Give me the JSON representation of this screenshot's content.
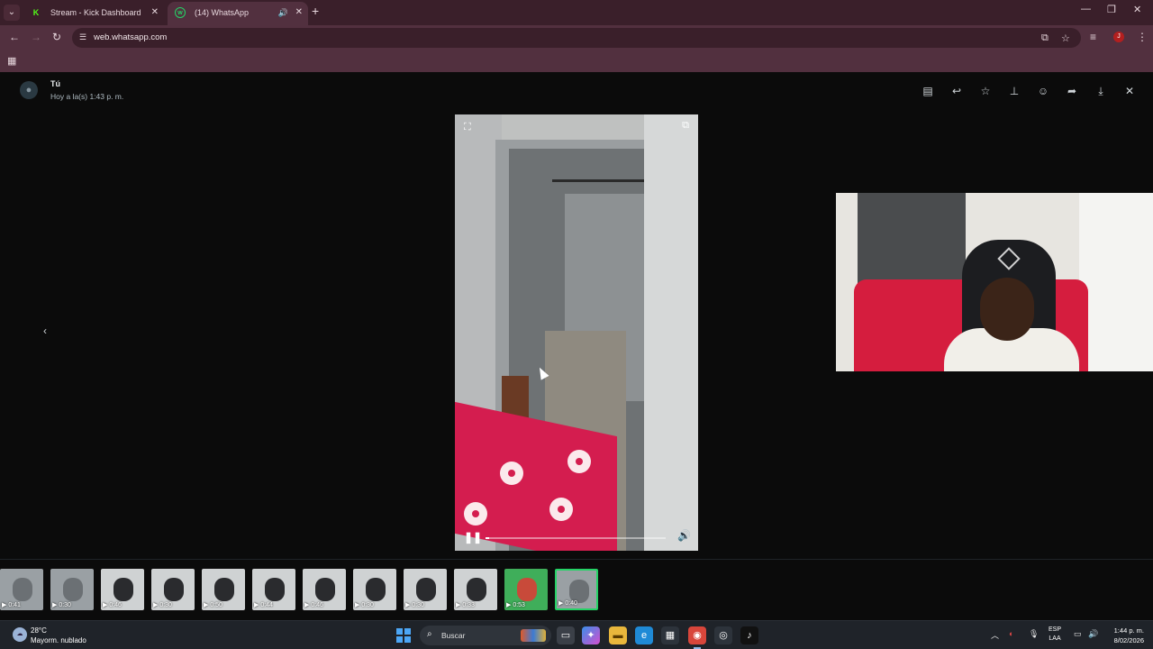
{
  "browser": {
    "tabs": [
      {
        "title": "Stream - Kick Dashboard",
        "favicon": "K"
      },
      {
        "title": "(14) WhatsApp",
        "favicon": "w"
      }
    ],
    "url": "web.whatsapp.com",
    "profile_initial": "J"
  },
  "viewer": {
    "sender_name": "Tú",
    "sender_time": "Hoy a la(s) 1:43 p. m.",
    "toolbar_icons": [
      "message-icon",
      "reply-icon",
      "star-icon",
      "pin-icon",
      "emoji-icon",
      "forward-icon",
      "download-icon",
      "close-icon"
    ],
    "video": {
      "state": "playing",
      "progress": 0.02
    },
    "filmstrip": [
      {
        "duration": "0:41",
        "kind": "room"
      },
      {
        "duration": "0:30",
        "kind": "room"
      },
      {
        "duration": "0:46",
        "kind": "person"
      },
      {
        "duration": "0:30",
        "kind": "person"
      },
      {
        "duration": "0:50",
        "kind": "person"
      },
      {
        "duration": "0:44",
        "kind": "person"
      },
      {
        "duration": "0:46",
        "kind": "person"
      },
      {
        "duration": "0:30",
        "kind": "person"
      },
      {
        "duration": "0:30",
        "kind": "person"
      },
      {
        "duration": "0:33",
        "kind": "person"
      },
      {
        "duration": "0:53",
        "kind": "art"
      },
      {
        "duration": "0:40",
        "kind": "room",
        "active": true
      }
    ]
  },
  "taskbar": {
    "weather_temp": "28°C",
    "weather_desc": "Mayorm. nublado",
    "search_placeholder": "Buscar",
    "language": "ESP",
    "region": "LAA",
    "time": "1:44 p. m.",
    "date": "8/02/2026"
  },
  "colors": {
    "whatsapp_green": "#25d366",
    "browser_frame": "#3a1f2a",
    "sofa_red": "#d41d4f"
  }
}
